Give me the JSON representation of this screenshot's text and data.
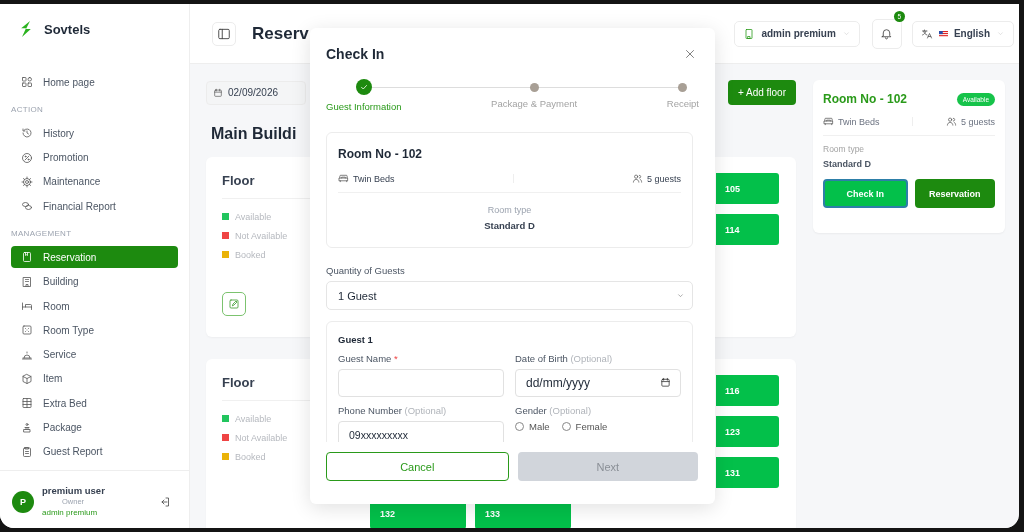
{
  "app": {
    "name": "Sovtels"
  },
  "sidebar": {
    "home": {
      "label": "Home page",
      "selected": false
    },
    "groups": [
      {
        "heading": "ACTION",
        "items": [
          {
            "label": "History",
            "selected": false
          },
          {
            "label": "Promotion",
            "selected": false
          },
          {
            "label": "Maintenance",
            "selected": false
          },
          {
            "label": "Financial Report",
            "selected": false
          }
        ]
      },
      {
        "heading": "MANAGEMENT",
        "items": [
          {
            "label": "Reservation",
            "selected": true
          },
          {
            "label": "Building",
            "selected": false
          },
          {
            "label": "Room",
            "selected": false
          },
          {
            "label": "Room Type",
            "selected": false
          },
          {
            "label": "Service",
            "selected": false
          },
          {
            "label": "Item",
            "selected": false
          },
          {
            "label": "Extra Bed",
            "selected": false
          },
          {
            "label": "Package",
            "selected": false
          },
          {
            "label": "Guest Report",
            "selected": false
          }
        ]
      }
    ],
    "user": {
      "initial": "P",
      "name": "premium user",
      "role": "Owner",
      "account": "admin premium"
    }
  },
  "header": {
    "title": "Reserv",
    "account": "admin premium",
    "notifications": "5",
    "language": "English"
  },
  "toolbar": {
    "date": "02/09/2026",
    "add_button": "+ Add floor"
  },
  "building": {
    "title": "Main Buildi"
  },
  "floors": [
    {
      "title": "Floor",
      "edit": true,
      "legend": [
        {
          "label": "Available",
          "color": "#22c55e"
        },
        {
          "label": "Not Available",
          "color": "#ef4444"
        },
        {
          "label": "Booked",
          "color": "#eab308"
        }
      ],
      "room_rows": [
        [
          "105"
        ],
        [
          "114"
        ]
      ]
    },
    {
      "title": "Floor",
      "edit": false,
      "legend": [
        {
          "label": "Available",
          "color": "#22c55e"
        },
        {
          "label": "Not Available",
          "color": "#ef4444"
        },
        {
          "label": "Booked",
          "color": "#eab308"
        }
      ],
      "room_rows": [
        [
          "116"
        ],
        [
          "123"
        ],
        [
          "131"
        ],
        [
          "132",
          "133"
        ]
      ]
    }
  ],
  "room_card": {
    "title": "Room No - 102",
    "status": "Available",
    "beds": "Twin Beds",
    "guests": "5 guests",
    "type_label": "Room type",
    "type": "Standard D",
    "actions": [
      {
        "label": "Check In",
        "kind": "accent",
        "focused": true
      },
      {
        "label": "Reservation",
        "kind": "primary",
        "focused": false
      }
    ]
  },
  "modal": {
    "title": "Check In",
    "steps": [
      {
        "label": "Guest Information",
        "completed": true
      },
      {
        "label": "Package & Payment",
        "completed": false
      },
      {
        "label": "Receipt",
        "completed": false
      }
    ],
    "room": {
      "title": "Room No - 102",
      "beds": "Twin Beds",
      "guests": "5 guests",
      "type_label": "Room type",
      "type": "Standard D"
    },
    "quantity": {
      "label": "Quantity of Guests",
      "value": "1 Guest"
    },
    "guests": [
      {
        "heading": "Guest 1",
        "name": {
          "label": "Guest Name",
          "required_mark": "*"
        },
        "dob": {
          "label": "Date of Birth",
          "hint": "(Optional)",
          "placeholder": "dd/mm/yyyy"
        },
        "phone": {
          "label": "Phone Number",
          "hint": "(Optional)",
          "value": "09xxxxxxxxx"
        },
        "gender": {
          "label": "Gender",
          "hint": "(Optional)",
          "options": [
            {
              "label": "Male",
              "selected": false
            },
            {
              "label": "Female",
              "selected": false
            }
          ]
        }
      }
    ],
    "buttons": [
      {
        "label": "Cancel",
        "kind": "secondary",
        "disabled": false
      },
      {
        "label": "Next",
        "kind": "primary",
        "disabled": true
      }
    ]
  }
}
